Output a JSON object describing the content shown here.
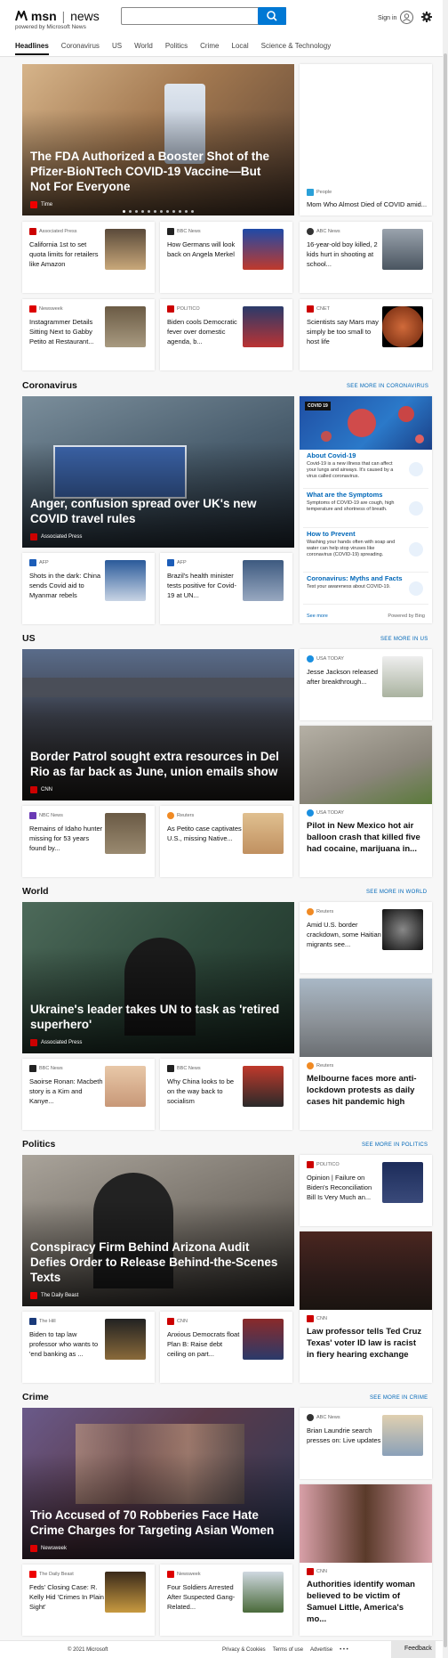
{
  "header": {
    "brand": "msn",
    "divider": "|",
    "product": "news",
    "powered_by": "powered by Microsoft News",
    "search_placeholder": "",
    "signin_label": "Sign in"
  },
  "nav": [
    "Headlines",
    "Coronavirus",
    "US",
    "World",
    "Politics",
    "Crime",
    "Local",
    "Science & Technology"
  ],
  "headlines": {
    "hero": {
      "title": "The FDA Authorized a Booster Shot of the Pfizer-BioNTech COVID-19 Vaccine—But Not For Everyone",
      "source": "Time"
    },
    "side": {
      "source": "People",
      "title": "Mom Who Almost Died of COVID amid..."
    },
    "cards": [
      {
        "source": "Associated Press",
        "title": "California 1st to set quota limits for retailers like Amazon"
      },
      {
        "source": "BBC News",
        "title": "How Germans will look back on Angela Merkel"
      },
      {
        "source": "ABC News",
        "title": "16-year-old boy killed, 2 kids hurt in shooting at school..."
      },
      {
        "source": "Newsweek",
        "title": "Instagrammer Details Sitting Next to Gabby Petito at Restaurant..."
      },
      {
        "source": "POLITICO",
        "title": "Biden cools Democratic fever over domestic agenda, b..."
      },
      {
        "source": "CNET",
        "title": "Scientists say Mars may simply be too small to host life"
      }
    ]
  },
  "coronavirus": {
    "title": "Coronavirus",
    "see_more": "SEE MORE IN CORONAVIRUS",
    "hero": {
      "title": "Anger, confusion spread over UK's new COVID travel rules",
      "source": "Associated Press"
    },
    "cards": [
      {
        "source": "AFP",
        "title": "Shots in the dark: China sends Covid aid to Myanmar rebels"
      },
      {
        "source": "AFP",
        "title": "Brazil's health minister tests positive for Covid-19 at UN..."
      }
    ],
    "info": {
      "badge": "COVID 19",
      "panels": [
        {
          "heading": "About Covid-19",
          "text": "Covid-19 is a new illness that can affect your lungs and airways. It's caused by a virus called coronavirus."
        },
        {
          "heading": "What are the Symptoms",
          "text": "Symptoms of COVID-19 are cough, high temperature and shortness of breath."
        },
        {
          "heading": "How to Prevent",
          "text": "Washing your hands often with soap and water can help stop viruses like coronavirus (COVID-19) spreading."
        },
        {
          "heading": "Coronavirus: Myths and Facts",
          "text": "Test your awareness about COVID-19."
        }
      ],
      "see_more": "See more",
      "powered": "Powered by Bing"
    }
  },
  "us": {
    "title": "US",
    "see_more": "SEE MORE IN US",
    "hero": {
      "title": "Border Patrol sought extra resources in Del Rio as far back as June, union emails show",
      "source": "CNN"
    },
    "side_top": {
      "source": "USA TODAY",
      "title": "Jesse Jackson released after breakthrough..."
    },
    "side_big": {
      "source": "USA TODAY",
      "title": "Pilot in New Mexico hot air balloon crash that killed five had cocaine, marijuana in..."
    },
    "cards": [
      {
        "source": "NBC News",
        "title": "Remains of Idaho hunter missing for 53 years found by..."
      },
      {
        "source": "Reuters",
        "title": "As Petito case captivates U.S., missing Native..."
      }
    ]
  },
  "world": {
    "title": "World",
    "see_more": "SEE MORE IN WORLD",
    "hero": {
      "title": "Ukraine's leader takes UN to task as 'retired superhero'",
      "source": "Associated Press"
    },
    "side_top": {
      "source": "Reuters",
      "title": "Amid U.S. border crackdown, some Haitian migrants see..."
    },
    "side_big": {
      "source": "Reuters",
      "title": "Melbourne faces more anti-lockdown protests as daily cases hit pandemic high"
    },
    "cards": [
      {
        "source": "BBC News",
        "title": "Saoirse Ronan: Macbeth story is a Kim and Kanye..."
      },
      {
        "source": "BBC News",
        "title": "Why China looks to be on the way back to socialism"
      }
    ]
  },
  "politics": {
    "title": "Politics",
    "see_more": "SEE MORE IN POLITICS",
    "hero": {
      "title": "Conspiracy Firm Behind Arizona Audit Defies Order to Release Behind-the-Scenes Texts",
      "source": "The Daily Beast"
    },
    "side_top": {
      "source": "POLITICO",
      "title": "Opinion | Failure on Biden's Reconciliation Bill Is Very Much an..."
    },
    "side_big": {
      "source": "CNN",
      "title": "Law professor tells Ted Cruz Texas' voter ID law is racist in fiery hearing exchange"
    },
    "cards": [
      {
        "source": "The Hill",
        "title": "Biden to tap law professor who wants to 'end banking as ..."
      },
      {
        "source": "CNN",
        "title": "Anxious Democrats float Plan B: Raise debt ceiling on part..."
      }
    ]
  },
  "crime": {
    "title": "Crime",
    "see_more": "SEE MORE IN CRIME",
    "hero": {
      "title": "Trio Accused of 70 Robberies Face Hate Crime Charges for Targeting Asian Women",
      "source": "Newsweek"
    },
    "side_top": {
      "source": "ABC News",
      "title": "Brian Laundrie search presses on: Live updates"
    },
    "side_big": {
      "source": "CNN",
      "title": "Authorities identify woman believed to be victim of Samuel Little, America's mo..."
    },
    "cards": [
      {
        "source": "The Daily Beast",
        "title": "Feds' Closing Case: R. Kelly Hid 'Crimes In Plain Sight'"
      },
      {
        "source": "Newsweek",
        "title": "Four Soldiers Arrested After Suspected Gang-Related..."
      }
    ]
  },
  "footer": {
    "copyright": "© 2021 Microsoft",
    "links": [
      "Privacy & Cookies",
      "Terms of use",
      "Advertise",
      "• • •"
    ],
    "feedback": "Feedback"
  }
}
